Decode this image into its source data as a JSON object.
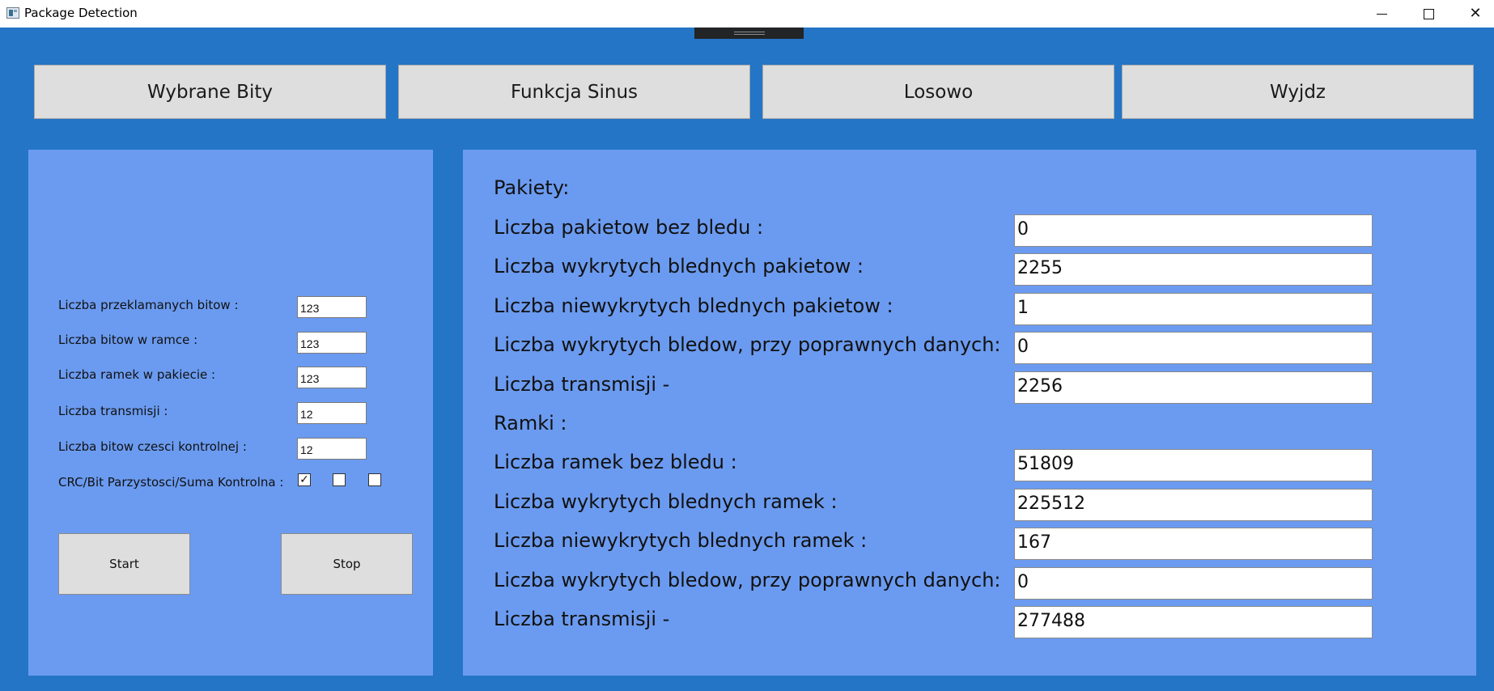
{
  "window": {
    "title": "Package Detection",
    "icon": "app-window-icon",
    "controls": [
      "minimize-icon",
      "maximize-icon",
      "close-icon"
    ],
    "close_glyph": "✕"
  },
  "top_buttons": [
    "Wybrane Bity",
    "Funkcja Sinus",
    "Losowo",
    "Wyjdz"
  ],
  "parameters": {
    "rows": [
      {
        "label": "Liczba przeklamanych bitow :",
        "value": "123"
      },
      {
        "label": "Liczba bitow w ramce :",
        "value": "123"
      },
      {
        "label": "Liczba ramek w pakiecie :",
        "value": "123"
      },
      {
        "label": "Liczba transmisji :",
        "value": "12"
      },
      {
        "label": "Liczba bitow czesci kontrolnej :",
        "value": "12"
      }
    ],
    "check_label": "CRC/Bit Parzystosci/Suma Kontrolna :",
    "checkboxes": [
      {
        "name": "CRC",
        "checked": true,
        "mark": "✓"
      },
      {
        "name": "Bit Parzystosci",
        "checked": false,
        "mark": ""
      },
      {
        "name": "Suma Kontrolna",
        "checked": false,
        "mark": ""
      }
    ],
    "start_label": "Start",
    "stop_label": "Stop"
  },
  "results": {
    "packets_header": "Pakiety:",
    "packets": [
      {
        "label": "Liczba pakietow bez bledu :",
        "value": "0"
      },
      {
        "label": "Liczba wykrytych blednych pakietow :",
        "value": "2255"
      },
      {
        "label": "Liczba niewykrytych blednych pakietow :",
        "value": "1"
      },
      {
        "label": "Liczba wykrytych bledow, przy poprawnych danych:",
        "value": "0"
      },
      {
        "label": "Liczba transmisji -",
        "value": "2256"
      }
    ],
    "frames_header": "Ramki :",
    "frames": [
      {
        "label": "Liczba ramek bez bledu :",
        "value": "51809"
      },
      {
        "label": "Liczba wykrytych blednych ramek :",
        "value": "225512"
      },
      {
        "label": "Liczba niewykrytych blednych ramek :",
        "value": "167"
      },
      {
        "label": "Liczba wykrytych bledow, przy poprawnych danych:",
        "value": "0"
      },
      {
        "label": "Liczba transmisji -",
        "value": "277488"
      }
    ]
  },
  "colors": {
    "background": "#2475c6",
    "panel": "#6b9bf0",
    "button": "#dedede"
  }
}
